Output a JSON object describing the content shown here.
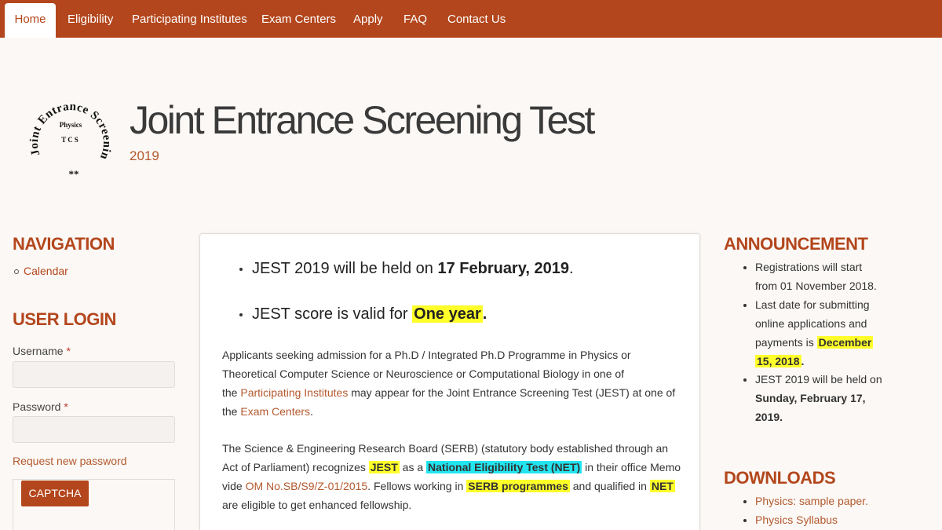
{
  "nav": {
    "tabs": [
      "Home",
      "Eligibility",
      "Participating Institutes",
      "Exam Centers",
      "Apply",
      "FAQ",
      "Contact Us"
    ],
    "active": "Home"
  },
  "header": {
    "title": "Joint Entrance Screening Test",
    "year": "2019",
    "logo": {
      "ring_text": "Joint Entrance Screening Test",
      "line1": "Physics",
      "line2": "TCS",
      "mark": "**"
    }
  },
  "left_sidebar": {
    "navigation_title": "NAVIGATION",
    "calendar_link": "Calendar",
    "login_title": "USER LOGIN",
    "username_label": "Username",
    "password_label": "Password",
    "required_mark": "*",
    "request_password": "Request new password",
    "captcha_label": "CAPTCHA"
  },
  "main": {
    "highlight1": {
      "prefix": "JEST 2019 will be held on ",
      "date": "17 February, 2019",
      "suffix": "."
    },
    "highlight2": {
      "prefix": "JEST score is valid for ",
      "validity": "One year",
      "suffix": "."
    },
    "para1": {
      "line1": "Applicants seeking admission  for a Ph.D / Integrated Ph.D Programme in Physics or",
      "line2": "Theoretical Computer Science or Neuroscience or Computational Biology in  one  of",
      "line3_pre": "the ",
      "line3_link": "Participating Institutes",
      "line3_post": " may appear for the Joint Entrance Screening Test (JEST) at one of",
      "line4_pre": "the ",
      "line4_link": "Exam Centers",
      "line4_post": "."
    },
    "para2": {
      "line1": "The Science & Engineering Research Board (SERB) (statutory body established through an",
      "line2_pre": "Act of Parliament) recognizes ",
      "line2_hl1": "JEST",
      "line2_mid": " as a ",
      "line2_hl2": "National Eligibility Test (NET)",
      "line2_post": " in their office Memo",
      "line3_pre": "vide ",
      "line3_link": "OM No.SB/S9/Z-01/2015",
      "line3_mid": ".  Fellows working in ",
      "line3_hl": "SERB programmes",
      "line3_mid2": " and qualified in ",
      "line3_hl2": "NET",
      "line4": "are eligible to get enhanced fellowship."
    }
  },
  "right_sidebar": {
    "announcement_title": "ANNOUNCEMENT",
    "ann1_line1": "Registrations will start",
    "ann1_line2": "from 01 November 2018.",
    "ann2_line1": "Last date for submitting",
    "ann2_line2": "online applications and",
    "ann2_line3_pre": "payments is ",
    "ann2_hl1": "December",
    "ann2_hl2": "15, 2018",
    "ann2_end": ".",
    "ann3_line1": "JEST 2019 will be held on",
    "ann3_line2": "Sunday, February 17,",
    "ann3_line3": "2019.",
    "downloads_title": "DOWNLOADS",
    "dl1": "Physics: sample paper.",
    "dl2": "Physics Syllabus"
  },
  "colors": {
    "brand": "#b3461c",
    "link": "#b3592e",
    "highlight_yellow": "#ffff2a",
    "highlight_cyan": "#22e5f0"
  }
}
